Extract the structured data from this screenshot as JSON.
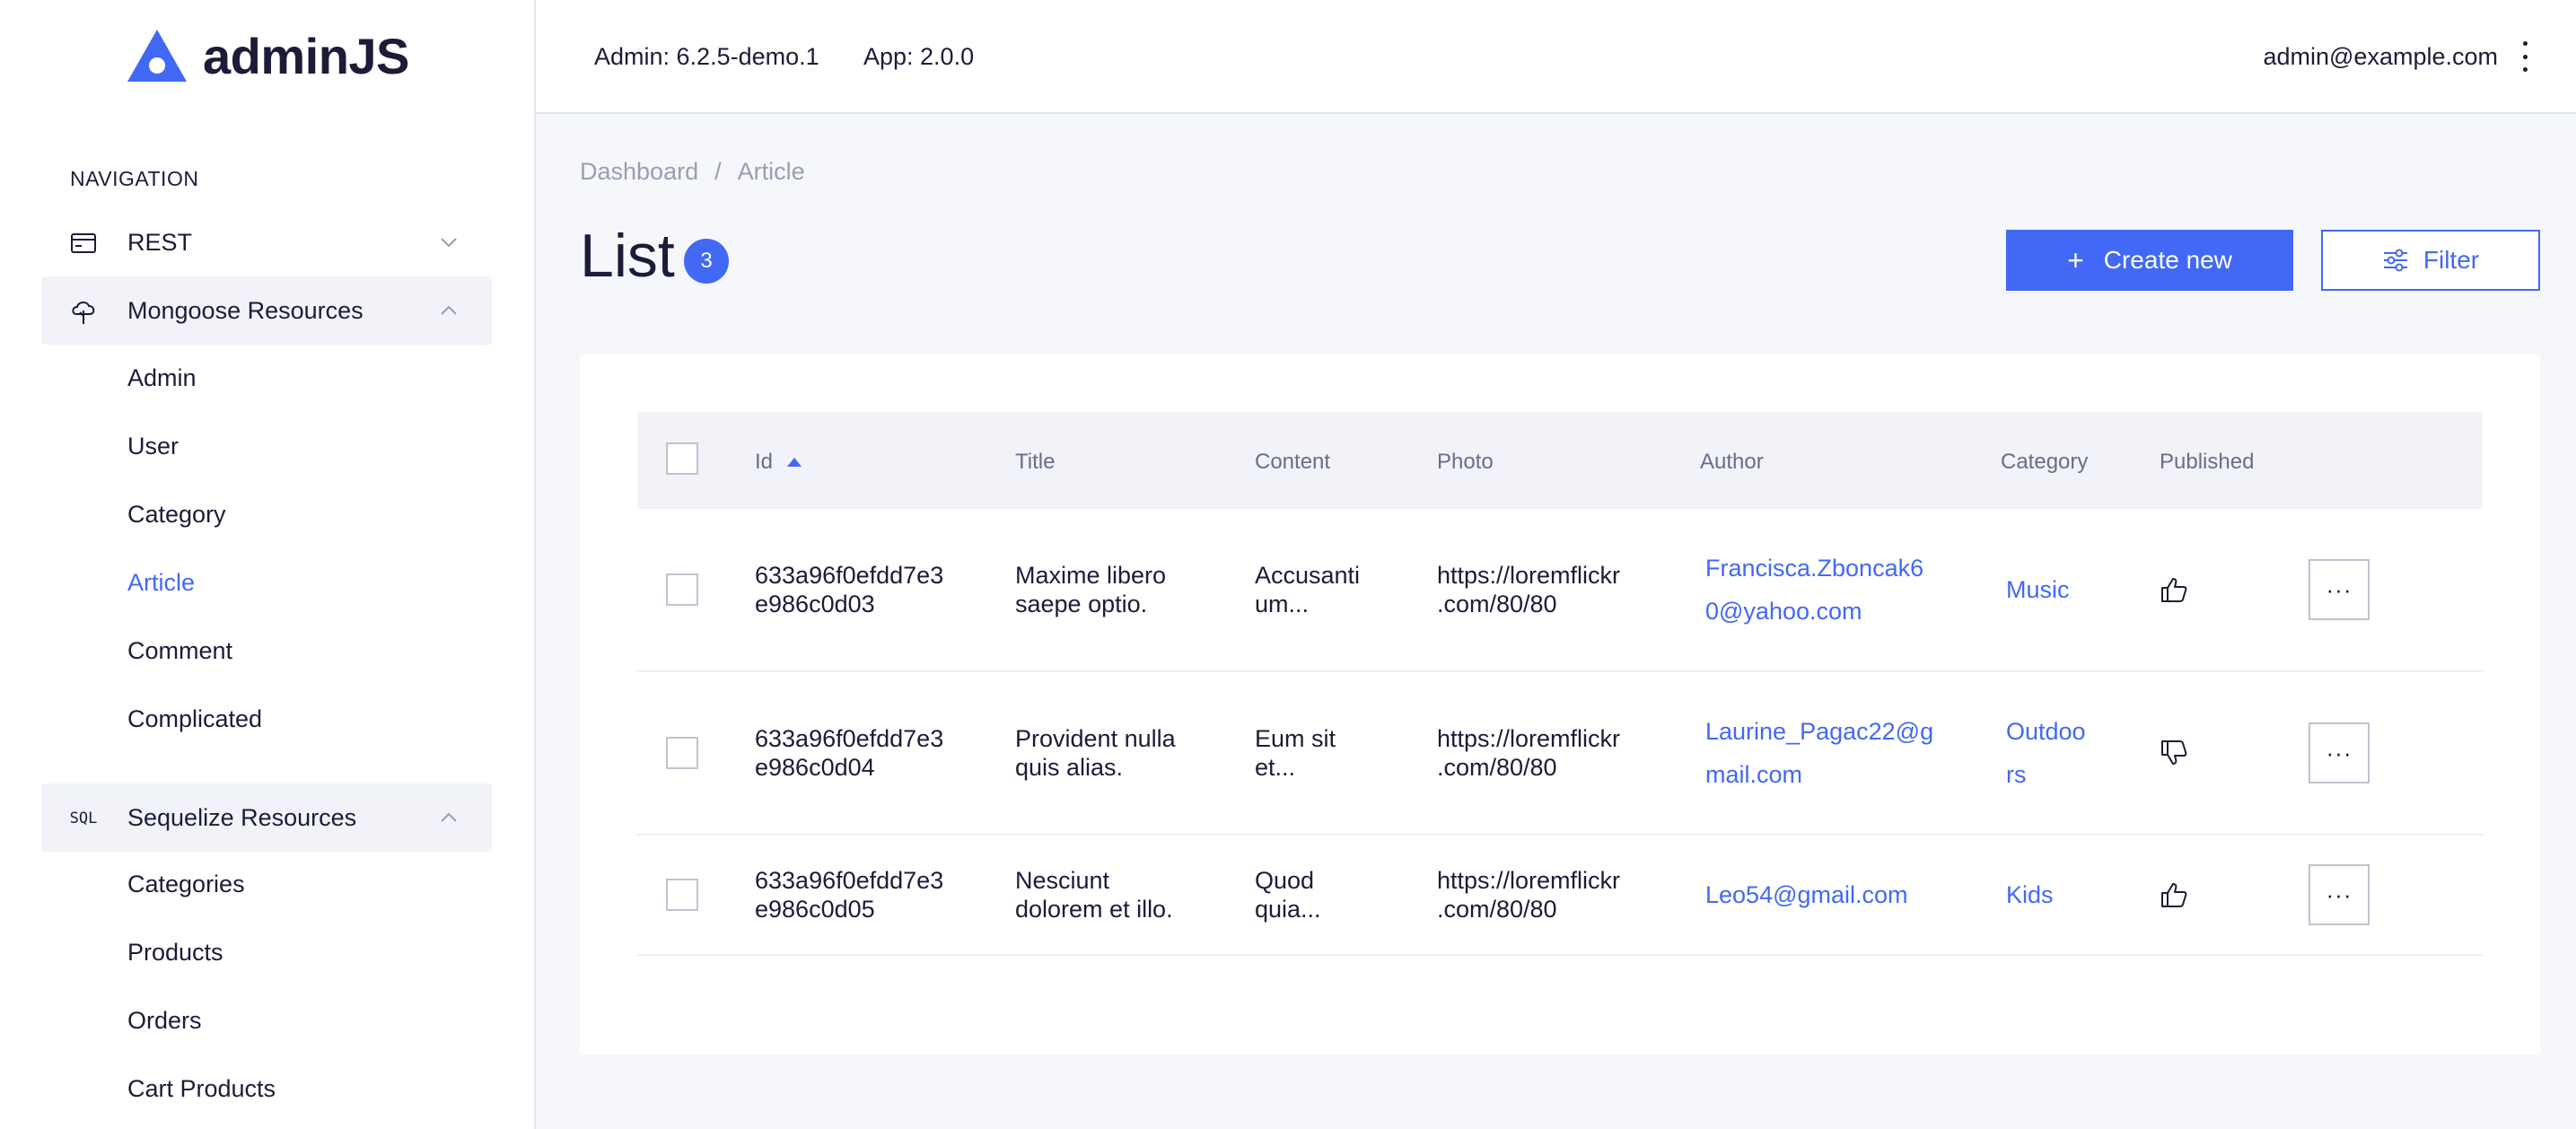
{
  "brand": {
    "name": "adminJS",
    "accent": "#4268f6"
  },
  "sidebar": {
    "nav_label": "NAVIGATION",
    "groups": [
      {
        "label": "REST",
        "icon": "credit-card-icon",
        "expanded": false
      },
      {
        "label": "Mongoose Resources",
        "icon": "cloud-tree-icon",
        "expanded": true
      },
      {
        "label": "Sequelize Resources",
        "icon": "sql-icon",
        "expanded": true
      }
    ],
    "mongoose_items": [
      "Admin",
      "User",
      "Category",
      "Article",
      "Comment",
      "Complicated"
    ],
    "sequelize_items": [
      "Categories",
      "Products",
      "Orders",
      "Cart Products"
    ],
    "sql_icon_text": "SQL"
  },
  "topbar": {
    "admin_version": "Admin: 6.2.5-demo.1",
    "app_version": "App: 2.0.0",
    "user_email": "admin@example.com"
  },
  "breadcrumb": {
    "items": [
      "Dashboard",
      "/",
      "Article"
    ]
  },
  "page": {
    "title": "List",
    "count": "3",
    "create_label": "Create new",
    "filter_label": "Filter"
  },
  "table": {
    "columns": [
      "Id",
      "Title",
      "Content",
      "Photo",
      "Author",
      "Category",
      "Published"
    ],
    "rows": [
      {
        "id_1": "633a96f0efdd7e3",
        "id_2": "e986c0d03",
        "title_1": "Maxime libero",
        "title_2": "saepe optio.",
        "content_1": "Accusanti",
        "content_2": "um...",
        "photo_1": "https://loremflickr",
        "photo_2": ".com/80/80",
        "author_1": "Francisca.Zboncak6",
        "author_2": "0@yahoo.com",
        "category_1": "Music",
        "category_2": "",
        "published": "thumb-up-icon",
        "more": "···"
      },
      {
        "id_1": "633a96f0efdd7e3",
        "id_2": "e986c0d04",
        "title_1": "Provident nulla",
        "title_2": "quis alias.",
        "content_1": "Eum sit",
        "content_2": "et...",
        "photo_1": "https://loremflickr",
        "photo_2": ".com/80/80",
        "author_1": "Laurine_Pagac22@g",
        "author_2": "mail.com",
        "category_1": "Outdoo",
        "category_2": "rs",
        "published": "thumb-down-icon",
        "more": "···"
      },
      {
        "id_1": "633a96f0efdd7e3",
        "id_2": "e986c0d05",
        "title_1": "Nesciunt",
        "title_2": "dolorem et illo.",
        "content_1": "Quod",
        "content_2": "quia...",
        "photo_1": "https://loremflickr",
        "photo_2": ".com/80/80",
        "author_1": "Leo54@gmail.com",
        "author_2": "",
        "category_1": "Kids",
        "category_2": "",
        "published": "thumb-up-icon",
        "more": "···"
      }
    ]
  }
}
